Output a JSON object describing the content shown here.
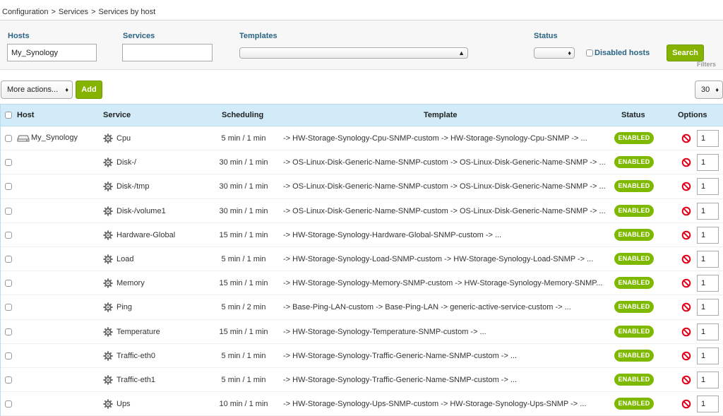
{
  "breadcrumb": [
    "Configuration",
    "Services",
    "Services by host"
  ],
  "breadcrumb_separator": ">",
  "filters": {
    "hosts_label": "Hosts",
    "hosts_value": "My_Synology",
    "services_label": "Services",
    "services_value": "",
    "templates_label": "Templates",
    "templates_value": "",
    "status_label": "Status",
    "status_value": "",
    "disabled_hosts_label": "Disabled hosts",
    "search_label": "Search",
    "filters_link": "Filters"
  },
  "toolbar": {
    "more_actions_label": "More actions...",
    "add_label": "Add",
    "page_limit": "30"
  },
  "table": {
    "headers": {
      "host": "Host",
      "service": "Service",
      "scheduling": "Scheduling",
      "template": "Template",
      "status": "Status",
      "options": "Options"
    },
    "rows": [
      {
        "host": "My_Synology",
        "service": "Cpu",
        "scheduling": "5 min / 1 min",
        "template": "-> HW-Storage-Synology-Cpu-SNMP-custom -> HW-Storage-Synology-Cpu-SNMP -> ...",
        "status": "ENABLED",
        "dup": "1"
      },
      {
        "host": "",
        "service": "Disk-/",
        "scheduling": "30 min / 1 min",
        "template": "-> OS-Linux-Disk-Generic-Name-SNMP-custom -> OS-Linux-Disk-Generic-Name-SNMP -> ...",
        "status": "ENABLED",
        "dup": "1"
      },
      {
        "host": "",
        "service": "Disk-/tmp",
        "scheduling": "30 min / 1 min",
        "template": "-> OS-Linux-Disk-Generic-Name-SNMP-custom -> OS-Linux-Disk-Generic-Name-SNMP -> ...",
        "status": "ENABLED",
        "dup": "1"
      },
      {
        "host": "",
        "service": "Disk-/volume1",
        "scheduling": "30 min / 1 min",
        "template": "-> OS-Linux-Disk-Generic-Name-SNMP-custom -> OS-Linux-Disk-Generic-Name-SNMP -> ...",
        "status": "ENABLED",
        "dup": "1"
      },
      {
        "host": "",
        "service": "Hardware-Global",
        "scheduling": "15 min / 1 min",
        "template": "-> HW-Storage-Synology-Hardware-Global-SNMP-custom -> ...",
        "status": "ENABLED",
        "dup": "1"
      },
      {
        "host": "",
        "service": "Load",
        "scheduling": "5 min / 1 min",
        "template": "-> HW-Storage-Synology-Load-SNMP-custom -> HW-Storage-Synology-Load-SNMP -> ...",
        "status": "ENABLED",
        "dup": "1"
      },
      {
        "host": "",
        "service": "Memory",
        "scheduling": "15 min / 1 min",
        "template": "-> HW-Storage-Synology-Memory-SNMP-custom -> HW-Storage-Synology-Memory-SNMP...",
        "status": "ENABLED",
        "dup": "1"
      },
      {
        "host": "",
        "service": "Ping",
        "scheduling": "5 min / 2 min",
        "template": "-> Base-Ping-LAN-custom -> Base-Ping-LAN -> generic-active-service-custom -> ...",
        "status": "ENABLED",
        "dup": "1"
      },
      {
        "host": "",
        "service": "Temperature",
        "scheduling": "15 min / 1 min",
        "template": "-> HW-Storage-Synology-Temperature-SNMP-custom -> ...",
        "status": "ENABLED",
        "dup": "1"
      },
      {
        "host": "",
        "service": "Traffic-eth0",
        "scheduling": "5 min / 1 min",
        "template": "-> HW-Storage-Synology-Traffic-Generic-Name-SNMP-custom -> ...",
        "status": "ENABLED",
        "dup": "1"
      },
      {
        "host": "",
        "service": "Traffic-eth1",
        "scheduling": "5 min / 1 min",
        "template": "-> HW-Storage-Synology-Traffic-Generic-Name-SNMP-custom -> ...",
        "status": "ENABLED",
        "dup": "1"
      },
      {
        "host": "",
        "service": "Ups",
        "scheduling": "10 min / 1 min",
        "template": "-> HW-Storage-Synology-Ups-SNMP-custom -> HW-Storage-Synology-Ups-SNMP -> ...",
        "status": "ENABLED",
        "dup": "1"
      }
    ]
  },
  "icons": {
    "host": "server-icon",
    "service": "gear-icon",
    "disable": "no-entry-icon",
    "select": "chevron-updown-icon"
  },
  "colors": {
    "label_blue": "#2a6485",
    "accent_green": "#85b300",
    "badge_green": "#7eb900",
    "header_bg": "#d1ebf8",
    "disable_red": "#e2001a"
  }
}
